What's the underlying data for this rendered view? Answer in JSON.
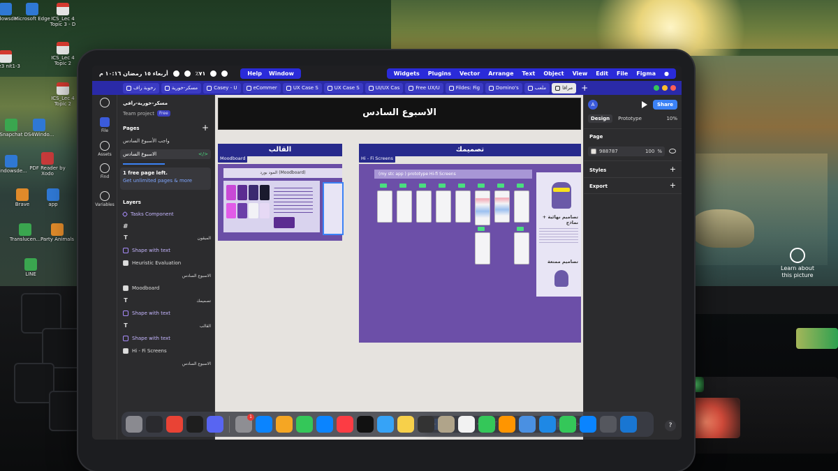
{
  "desktop": {
    "icons": [
      {
        "label": "windowsde...",
        "kind": "blue"
      },
      {
        "label": "Microsoft Edge",
        "kind": "blue"
      },
      {
        "label": "ICS_Lec 4 Topic 3 - D",
        "kind": "pdf"
      },
      {
        "label": "olve3 nit1-3",
        "kind": "pdf"
      },
      {
        "label": "ICS_Lec 4 Topic 2",
        "kind": "pdf"
      },
      {
        "label": "ICS_Lec 4 Topic 2",
        "kind": "pdf"
      },
      {
        "label": "Snapchat",
        "kind": "green"
      },
      {
        "label": "DS4Windo...",
        "kind": "blue"
      },
      {
        "label": "windowsde...",
        "kind": "blue"
      },
      {
        "label": "PDF Reader by Xodo",
        "kind": "red"
      },
      {
        "label": "Brave",
        "kind": "orange"
      },
      {
        "label": "app",
        "kind": "blue"
      },
      {
        "label": "Translucen...",
        "kind": "green"
      },
      {
        "label": "Party Animals",
        "kind": "orange"
      },
      {
        "label": "LINE",
        "kind": "green"
      }
    ],
    "learn_more": "Learn about this picture"
  },
  "status_bar": {
    "datetime": "أربعاء ١٥ رمضان ١٠:١٦ م",
    "battery": "٪٧١",
    "menu_left": [
      "Help",
      "Window"
    ],
    "menu_right": [
      "Widgets",
      "Plugins",
      "Vector",
      "Arrange",
      "Text",
      "Object",
      "View",
      "Edit",
      "File",
      "Figma"
    ]
  },
  "tabs": [
    "رخوبة راف",
    "مسكر-خورية",
    "Casey - U",
    "eCommer",
    "UX Case S",
    "UX Case S",
    "UI/UX Cas",
    "Free UX/U",
    "Fildes: Fig",
    "Domino's",
    "ملعب",
    "مرافا"
  ],
  "rail": [
    {
      "label": "File"
    },
    {
      "label": "Assets"
    },
    {
      "label": "Find"
    },
    {
      "label": "Variables"
    }
  ],
  "left_panel": {
    "file_name": "مسكر-خورية-رافي",
    "team": "Team project",
    "free_badge": "Free",
    "pages_heading": "Pages",
    "pages": [
      "واجب الأسبوع السادس",
      "الاسبوع السادس"
    ],
    "upgrade_line1": "1 free page left.",
    "upgrade_line2": "Get unlimited pages & more",
    "layers_heading": "Layers",
    "layers": [
      {
        "label": "Tasks Component",
        "kind": "comp"
      },
      {
        "label": "",
        "kind": "frame"
      },
      {
        "label": "الميقون",
        "kind": "text"
      },
      {
        "label": "Shape with text",
        "kind": "shape"
      },
      {
        "label": "Heuristic Evaluation",
        "kind": "frame"
      },
      {
        "label": "الاسبوع السادس",
        "kind": "text"
      },
      {
        "label": "Moodboard",
        "kind": "frame"
      },
      {
        "label": "تصميمك",
        "kind": "text"
      },
      {
        "label": "Shape with text",
        "kind": "shape"
      },
      {
        "label": "القالب",
        "kind": "text"
      },
      {
        "label": "Shape with text",
        "kind": "shape"
      },
      {
        "label": "Hi - Fi Screens",
        "kind": "frame"
      },
      {
        "label": "الاسبوع السادس",
        "kind": "text"
      }
    ]
  },
  "canvas": {
    "title": "الاسبوع السادس",
    "band_left": "القالب",
    "band_right": "تصميمك",
    "label_moodboard": "Moodboard",
    "label_hifi": "Hi - Fi Screens",
    "mood_title": "المود بورد (Moodboard)",
    "hifi_title": "(my stc app ) prototype Hi-fi Screens",
    "promo_text1": "تصاميم نهائية + نماذج",
    "promo_text2": "تصاميم ممتعة"
  },
  "right_panel": {
    "avatar": "A",
    "share": "Share",
    "tab_design": "Design",
    "tab_prototype": "Prototype",
    "zoom": "10%",
    "page_heading": "Page",
    "page_color": "988787",
    "page_opacity": "100",
    "opacity_unit": "%",
    "styles": "Styles",
    "export": "Export",
    "help": "?"
  },
  "dock": {
    "apps": [
      {
        "name": "Trash",
        "color": "#8a8a90"
      },
      {
        "name": "Screen",
        "color": "#2a2a2e"
      },
      {
        "name": "Chrome",
        "color": "#e94335"
      },
      {
        "name": "Figma",
        "color": "#1e1e1e"
      },
      {
        "name": "Discord",
        "color": "#5865f2"
      },
      {
        "name": "Settings",
        "color": "#8e8e93",
        "badge": "1"
      },
      {
        "name": "App Store",
        "color": "#0a84ff"
      },
      {
        "name": "Pages",
        "color": "#f5a623"
      },
      {
        "name": "Numbers",
        "color": "#34c759"
      },
      {
        "name": "Keynote",
        "color": "#0a84ff"
      },
      {
        "name": "Music",
        "color": "#fc3c44"
      },
      {
        "name": "TV",
        "color": "#111"
      },
      {
        "name": "Safari-ish",
        "color": "#36a3f7"
      },
      {
        "name": "Notes",
        "color": "#f7d04a"
      },
      {
        "name": "Calculator",
        "color": "#333"
      },
      {
        "name": "Contacts",
        "color": "#b0a48a"
      },
      {
        "name": "Calendar",
        "color": "#f2f2f2"
      },
      {
        "name": "FaceTime",
        "color": "#34c759"
      },
      {
        "name": "Photos",
        "color": "#ff9500"
      },
      {
        "name": "Testflight",
        "color": "#4a90e2"
      },
      {
        "name": "Mail",
        "color": "#1e88e5"
      },
      {
        "name": "Messages",
        "color": "#34c759"
      },
      {
        "name": "Safari",
        "color": "#0a84ff"
      },
      {
        "name": "Launchpad",
        "color": "#55575e"
      },
      {
        "name": "Files",
        "color": "#1976d2"
      }
    ]
  },
  "colors": {
    "accent": "#3b82f6",
    "menu_blue": "#2a2bd9",
    "section_band": "#272a8c",
    "hifi_purple": "#6c4fa8"
  }
}
